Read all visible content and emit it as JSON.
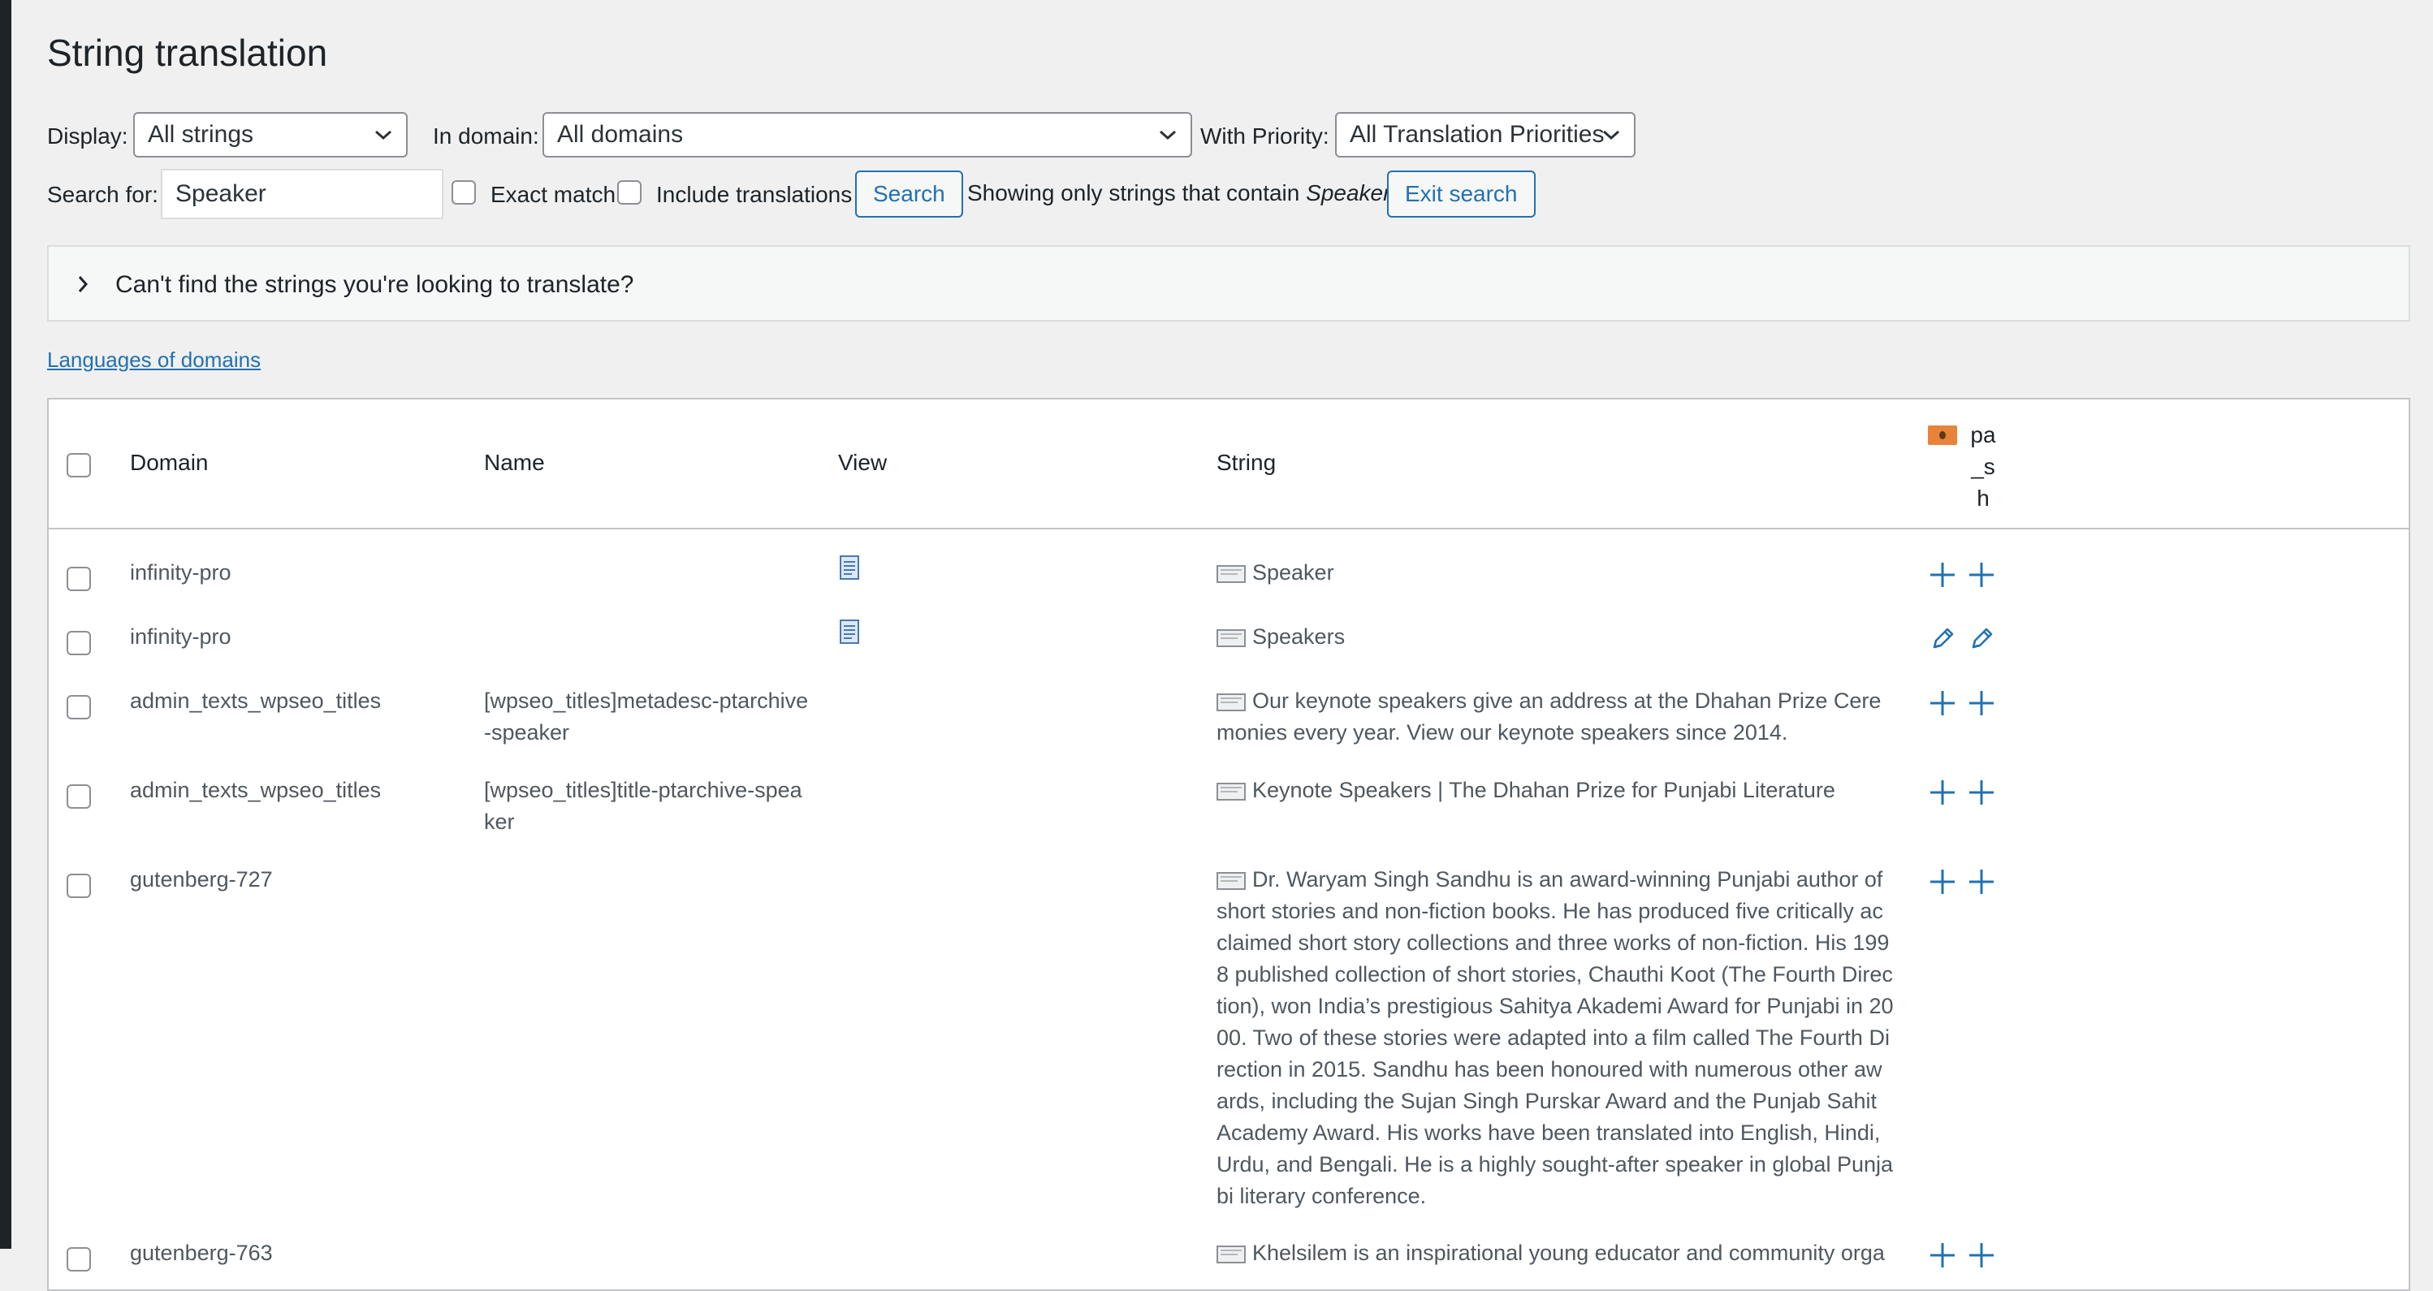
{
  "page": {
    "title": "String translation"
  },
  "filters": {
    "display_label": "Display:",
    "display_value": "All strings",
    "domain_label": "In domain:",
    "domain_value": "All domains",
    "priority_label": "With Priority:",
    "priority_value": "All Translation Priorities",
    "search_label": "Search for:",
    "search_value": "Speaker",
    "exact_match_label": "Exact match",
    "include_translations_label": "Include translations",
    "search_button": "Search",
    "notice_prefix": "Showing only strings that contain",
    "notice_term": "Speaker",
    "exit_search_button": "Exit search"
  },
  "accordion": {
    "text": "Can't find the strings you're looking to translate?"
  },
  "links": {
    "languages_of_domains": "Languages of domains"
  },
  "table": {
    "headers": {
      "domain": "Domain",
      "name": "Name",
      "view": "View",
      "string": "String"
    },
    "language": {
      "code_lines": [
        "pa",
        "_s",
        "h"
      ],
      "flag_color": "#e8833a"
    },
    "rows": [
      {
        "domain": "infinity-pro",
        "name": "",
        "has_view": true,
        "string": "Speaker",
        "actions": [
          "add",
          "add"
        ]
      },
      {
        "domain": "infinity-pro",
        "name": "",
        "has_view": true,
        "string": "Speakers",
        "actions": [
          "edit",
          "edit"
        ]
      },
      {
        "domain": "admin_texts_wpseo_titles",
        "name": "[wpseo_titles]metadesc-ptarchive-speaker",
        "has_view": false,
        "string": "Our keynote speakers give an address at the Dhahan Prize Ceremonies every year. View our keynote speakers since 2014.",
        "actions": [
          "add",
          "add"
        ]
      },
      {
        "domain": "admin_texts_wpseo_titles",
        "name": "[wpseo_titles]title-ptarchive-speaker",
        "has_view": false,
        "string": "Keynote Speakers | The Dhahan Prize for Punjabi Literature",
        "actions": [
          "add",
          "add"
        ]
      },
      {
        "domain": "gutenberg-727",
        "name": "",
        "has_view": false,
        "string": "Dr. Waryam Singh Sandhu is an award-winning Punjabi author of short stories and non-fiction books. He has produced five critically acclaimed short story collections and three works of non-fiction. His 1998 published collection of short stories, Chauthi Koot (The Fourth Direction), won India’s prestigious Sahitya Akademi Award for Punjabi in 2000. Two of these stories were adapted into a film called The Fourth Direction in 2015. Sandhu has been honoured with numerous other awards, including the Sujan Singh Purskar Award and the Punjab Sahit Academy Award. His works have been translated into English, Hindi, Urdu, and Bengali. He is a highly sought-after speaker in global Punjabi literary conference.",
        "actions": [
          "add",
          "add"
        ]
      },
      {
        "domain": "gutenberg-763",
        "name": "",
        "has_view": false,
        "string": "Khelsilem is an inspirational young educator and community orga",
        "actions": [
          "add",
          "add"
        ]
      }
    ]
  },
  "colors": {
    "accent": "#2271b1",
    "page_bg": "#f0f0f1",
    "sidebar": "#1d2327"
  }
}
